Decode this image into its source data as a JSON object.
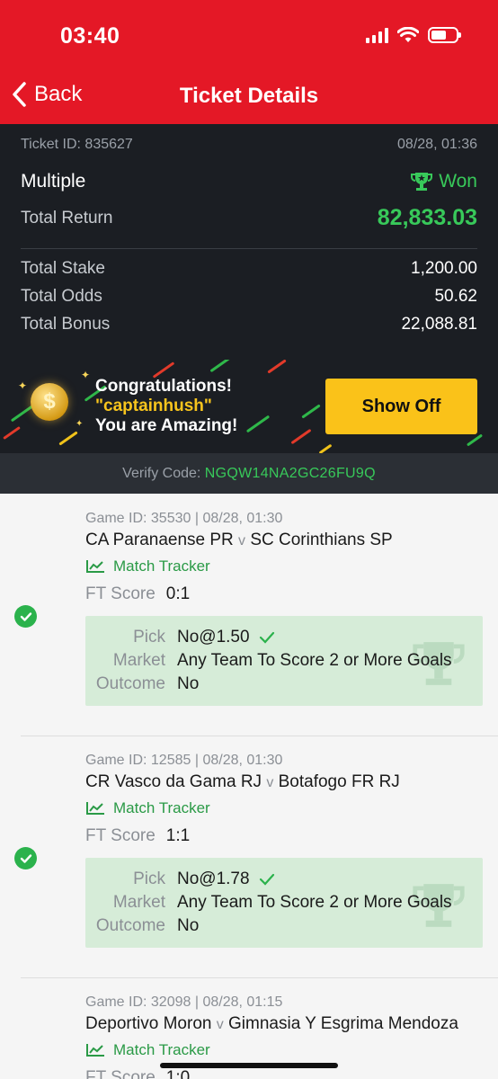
{
  "status_bar": {
    "time": "03:40"
  },
  "nav": {
    "back_label": "Back",
    "title": "Ticket Details"
  },
  "ticket": {
    "id_text": "Ticket ID: 835627",
    "datetime": "08/28, 01:36",
    "type": "Multiple",
    "status": "Won",
    "total_return_label": "Total Return",
    "total_return": "82,833.03",
    "rows": [
      {
        "label": "Total Stake",
        "value": "1,200.00"
      },
      {
        "label": "Total Odds",
        "value": "50.62"
      },
      {
        "label": "Total Bonus",
        "value": "22,088.81"
      }
    ]
  },
  "promo": {
    "line1": "Congratulations!",
    "line2": "\"captainhush\"",
    "line3": "You are Amazing!",
    "button": "Show Off"
  },
  "verify": {
    "label": "Verify Code:",
    "code": "NGQW14NA2GC26FU9Q"
  },
  "bets": [
    {
      "game": "Game ID: 35530 | 08/28, 01:30",
      "home": "CA Paranaense PR",
      "vs": "v",
      "away": "SC Corinthians SP",
      "tracker": "Match Tracker",
      "score_label": "FT Score",
      "score": "0:1",
      "pick_label": "Pick",
      "pick": "No@1.50",
      "market_label": "Market",
      "market": "Any Team To Score 2 or More Goals",
      "outcome_label": "Outcome",
      "outcome": "No"
    },
    {
      "game": "Game ID: 12585 | 08/28, 01:30",
      "home": "CR Vasco da Gama RJ",
      "vs": "v",
      "away": "Botafogo FR RJ",
      "tracker": "Match Tracker",
      "score_label": "FT Score",
      "score": "1:1",
      "pick_label": "Pick",
      "pick": "No@1.78",
      "market_label": "Market",
      "market": "Any Team To Score 2 or More Goals",
      "outcome_label": "Outcome",
      "outcome": "No"
    },
    {
      "game": "Game ID: 32098 | 08/28, 01:15",
      "home": "Deportivo Moron",
      "vs": "v",
      "away": "Gimnasia Y Esgrima Mendoza",
      "tracker": "Match Tracker",
      "score_label": "FT Score",
      "score": "1:0"
    }
  ],
  "colors": {
    "brand_red": "#e41826",
    "win_green": "#38c95a",
    "button_yellow": "#fac219"
  }
}
